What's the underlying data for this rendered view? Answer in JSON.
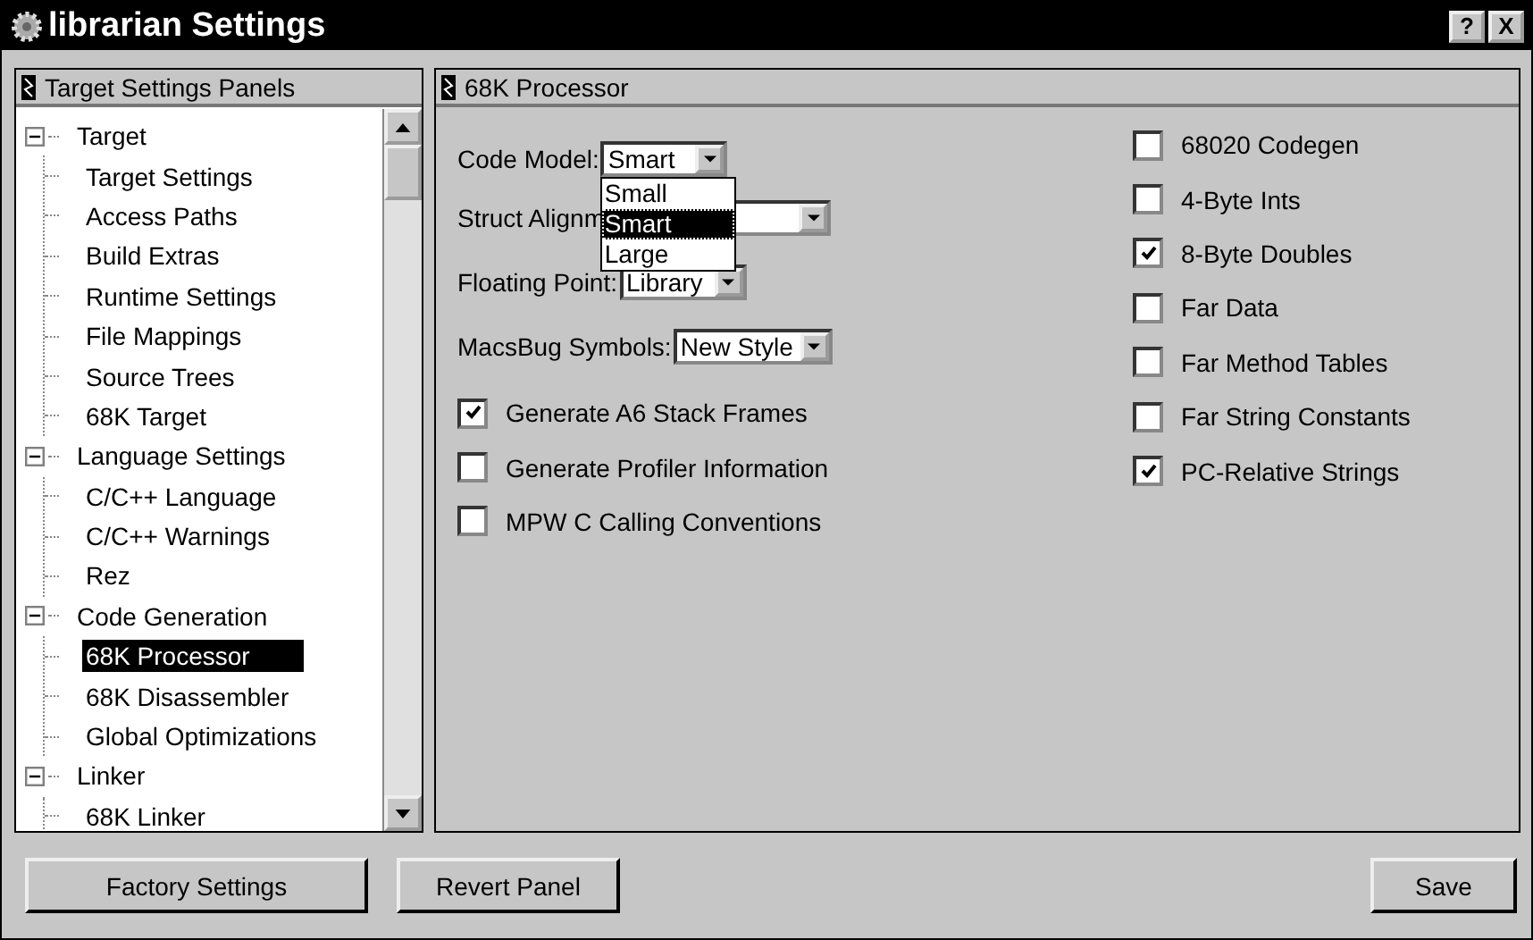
{
  "window": {
    "title": "librarian Settings",
    "help": "?",
    "close": "X"
  },
  "panels_list": {
    "title": "Target Settings Panels",
    "tree": [
      {
        "label": "Target",
        "expanded": true,
        "selected": false,
        "children": [
          {
            "label": "Target Settings",
            "selected": false
          },
          {
            "label": "Access Paths",
            "selected": false
          },
          {
            "label": "Build Extras",
            "selected": false
          },
          {
            "label": "Runtime Settings",
            "selected": false
          },
          {
            "label": "File Mappings",
            "selected": false
          },
          {
            "label": "Source Trees",
            "selected": false
          },
          {
            "label": "68K Target",
            "selected": false
          }
        ]
      },
      {
        "label": "Language Settings",
        "expanded": true,
        "selected": false,
        "children": [
          {
            "label": "C/C++ Language",
            "selected": false
          },
          {
            "label": "C/C++ Warnings",
            "selected": false
          },
          {
            "label": "Rez",
            "selected": false
          }
        ]
      },
      {
        "label": "Code Generation",
        "expanded": true,
        "selected": false,
        "children": [
          {
            "label": "68K Processor",
            "selected": true
          },
          {
            "label": "68K Disassembler",
            "selected": false
          },
          {
            "label": "Global Optimizations",
            "selected": false
          }
        ]
      },
      {
        "label": "Linker",
        "expanded": true,
        "selected": false,
        "children": [
          {
            "label": "68K Linker",
            "selected": false
          }
        ]
      }
    ]
  },
  "panel": {
    "title": "68K Processor",
    "selects": [
      {
        "label": "Code Model:",
        "value": "Smart",
        "open_options": [
          {
            "label": "Small",
            "selected": false
          },
          {
            "label": "Smart",
            "selected": true
          },
          {
            "label": "Large",
            "selected": false
          }
        ]
      },
      {
        "label": "Struct Alignm"
      },
      {
        "label": "Floating Point:",
        "value": "Library"
      },
      {
        "label": "MacsBug Symbols:",
        "value": "New Style"
      }
    ],
    "left_checkboxes": [
      {
        "label": "Generate A6 Stack Frames",
        "checked": true
      },
      {
        "label": "Generate Profiler Information",
        "checked": false
      },
      {
        "label": "MPW C Calling Conventions",
        "checked": false
      }
    ],
    "right_checkboxes": [
      {
        "label": "68020 Codegen",
        "checked": false
      },
      {
        "label": "4-Byte Ints",
        "checked": false
      },
      {
        "label": "8-Byte Doubles",
        "checked": true
      },
      {
        "label": "Far Data",
        "checked": false
      },
      {
        "label": "Far Method Tables",
        "checked": false
      },
      {
        "label": "Far String Constants",
        "checked": false
      },
      {
        "label": "PC-Relative Strings",
        "checked": true
      }
    ]
  },
  "buttons": [
    {
      "label": "Factory Settings",
      "kind": "left"
    },
    {
      "label": "Revert Panel",
      "kind": "left"
    },
    {
      "label": "Save",
      "kind": "right"
    }
  ]
}
